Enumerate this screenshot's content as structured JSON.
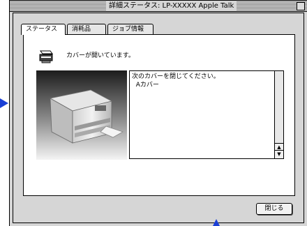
{
  "window": {
    "title": "詳細ステータス: LP-XXXXX  Apple Talk"
  },
  "tabs": [
    {
      "label": "ステータス",
      "active": true
    },
    {
      "label": "消耗品",
      "active": false
    },
    {
      "label": "ジョブ情報",
      "active": false
    }
  ],
  "status": {
    "message": "カバーが開いています。",
    "instructions": [
      "次のカバーを閉じてください。",
      "  Aカバー"
    ]
  },
  "buttons": {
    "close_label": "閉じる"
  },
  "colors": {
    "window_bg": "#d6d6d6",
    "panel_bg": "#ffffff",
    "arrow": "#1a3fd6"
  },
  "icons": [
    "printer-icon",
    "close-box-icon",
    "scroll-up-icon",
    "scroll-down-icon"
  ]
}
